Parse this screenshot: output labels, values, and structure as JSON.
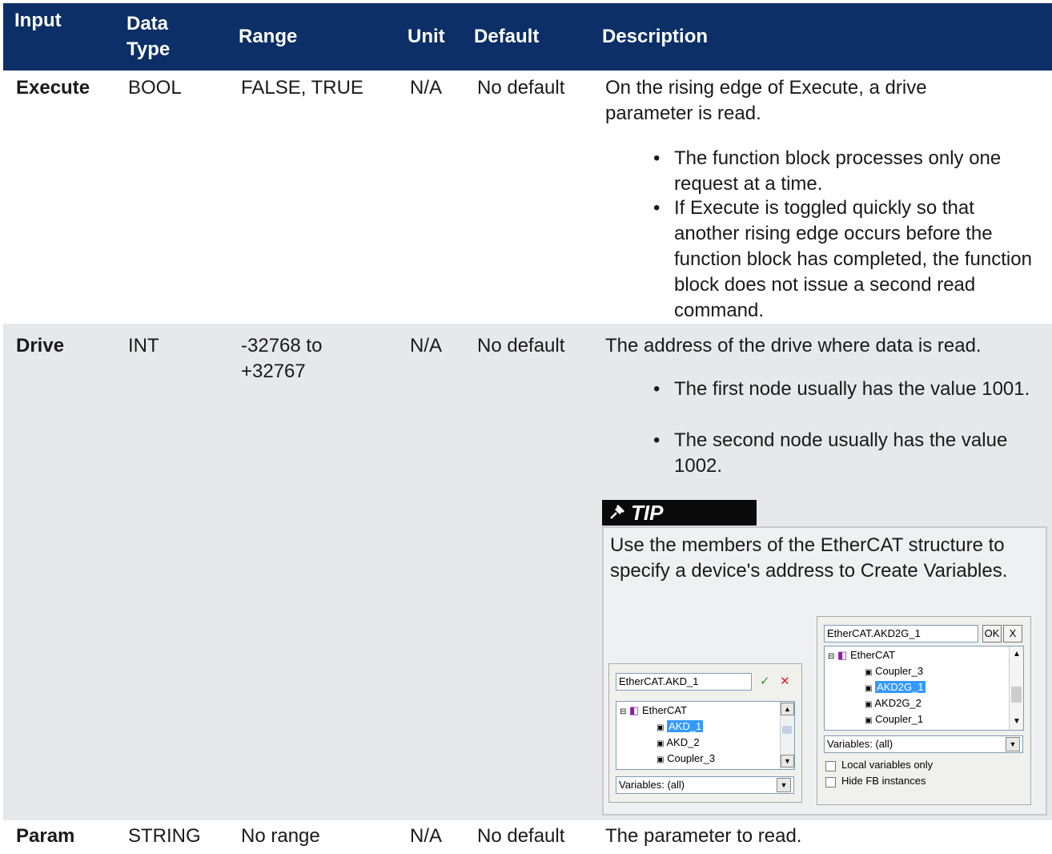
{
  "table": {
    "headers": [
      "Input",
      "Data Type",
      "Range",
      "Unit",
      "Default",
      "Description"
    ],
    "rows": [
      {
        "input": "Execute",
        "type": "BOOL",
        "range": "FALSE, TRUE",
        "unit": "N/A",
        "default": "No default",
        "description": "On the rising edge of Execute, a drive parameter is read.",
        "bullets": [
          "The function block processes only one request at a time.",
          "If Execute is toggled quickly so that another rising edge occurs before the function block has completed, the function block does not issue a second read command."
        ]
      },
      {
        "input": "Drive",
        "type": "INT",
        "range": "-32768 to +32767",
        "unit": "N/A",
        "default": "No default",
        "description": "The address of the drive where data is read.",
        "bullets": [
          "The first node usually has the value 1001.",
          "The second node usually has the value 1002."
        ]
      },
      {
        "input": "Param",
        "type": "STRING",
        "range": "No range",
        "unit": "N/A",
        "default": "No default",
        "description": "The parameter to read."
      }
    ]
  },
  "tip": {
    "label": "TIP",
    "text": "Use the members of the EtherCAT structure to specify a device's address to Create Variables."
  },
  "screenshot_left": {
    "field_value": "EtherCAT.AKD_1",
    "tree": [
      "EtherCAT",
      "AKD_1",
      "AKD_2",
      "Coupler_3"
    ],
    "selected": "AKD_1",
    "combo": "Variables: (all)"
  },
  "screenshot_right": {
    "field_value": "EtherCAT.AKD2G_1",
    "ok_label": "OK",
    "close_label": "X",
    "tree": [
      "EtherCAT",
      "Coupler_3",
      "AKD2G_1",
      "AKD2G_2",
      "Coupler_1"
    ],
    "selected": "AKD2G_1",
    "combo": "Variables: (all)",
    "checkboxes": [
      "Local variables only",
      "Hide FB instances"
    ]
  },
  "colors": {
    "header_bg": "#0b2f66",
    "row_alt_bg": "#e6e8eb",
    "selection": "#3399ff"
  }
}
